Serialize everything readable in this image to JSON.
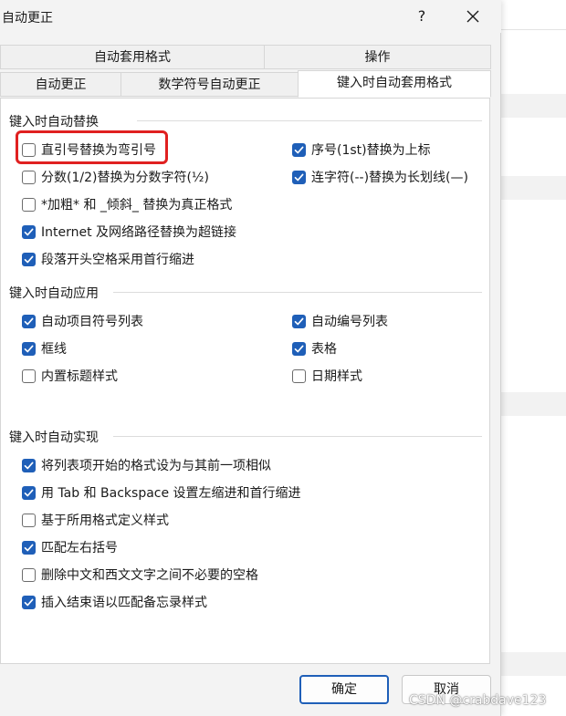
{
  "dialog": {
    "title": "自动更正",
    "help_label": "?"
  },
  "tabs": {
    "row1": [
      "自动套用格式",
      "操作"
    ],
    "row2": [
      "自动更正",
      "数学符号自动更正",
      "键入时自动套用格式"
    ],
    "active": "键入时自动套用格式"
  },
  "groups": {
    "replace": {
      "title": "键入时自动替换",
      "left": [
        {
          "label": "直引号替换为弯引号",
          "checked": false
        },
        {
          "label": "分数(1/2)替换为分数字符(½)",
          "checked": false
        },
        {
          "label": "*加粗* 和 _倾斜_ 替换为真正格式",
          "checked": false
        },
        {
          "label": "Internet 及网络路径替换为超链接",
          "checked": true
        },
        {
          "label": "段落开头空格采用首行缩进",
          "checked": true
        }
      ],
      "right": [
        {
          "label": "序号(1st)替换为上标",
          "checked": true
        },
        {
          "label": "连字符(--)替换为长划线(—)",
          "checked": true
        }
      ]
    },
    "apply": {
      "title": "键入时自动应用",
      "left": [
        {
          "label": "自动项目符号列表",
          "checked": true
        },
        {
          "label": "框线",
          "checked": true
        },
        {
          "label": "内置标题样式",
          "checked": false
        }
      ],
      "right": [
        {
          "label": "自动编号列表",
          "checked": true
        },
        {
          "label": "表格",
          "checked": true
        },
        {
          "label": "日期样式",
          "checked": false
        }
      ]
    },
    "auto": {
      "title": "键入时自动实现",
      "items": [
        {
          "label": "将列表项开始的格式设为与其前一项相似",
          "checked": true
        },
        {
          "label": "用 Tab 和 Backspace 设置左缩进和首行缩进",
          "checked": true
        },
        {
          "label": "基于所用格式定义样式",
          "checked": false
        },
        {
          "label": "匹配左右括号",
          "checked": true
        },
        {
          "label": "删除中文和西文文字之间不必要的空格",
          "checked": false
        },
        {
          "label": "插入结束语以匹配备忘录样式",
          "checked": true
        }
      ]
    }
  },
  "buttons": {
    "ok": "确定",
    "cancel": "取消"
  },
  "watermark": "CSDN @crabdave123",
  "colors": {
    "accent": "#1f5fb8",
    "highlight": "#e02020"
  }
}
